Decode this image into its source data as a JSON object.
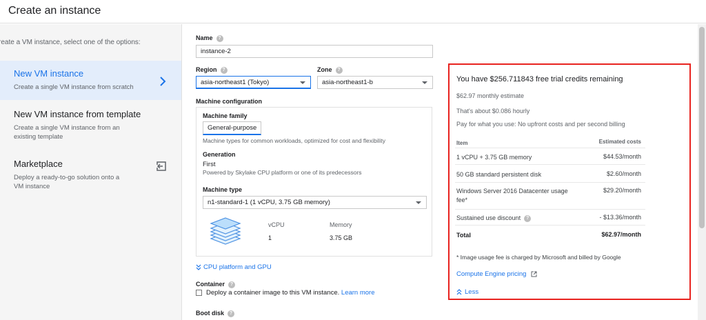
{
  "header": {
    "title": "Create an instance"
  },
  "left": {
    "intro": "reate a VM instance, select one of the options:",
    "options": [
      {
        "title": "New VM instance",
        "desc": "Create a single VM instance from scratch",
        "selected": true,
        "icon": "chevron-right-icon"
      },
      {
        "title": "New VM instance from template",
        "desc": "Create a single VM instance from an existing template",
        "selected": false
      },
      {
        "title": "Marketplace",
        "desc": "Deploy a ready-to-go solution onto a VM instance",
        "selected": false,
        "icon": "exit-to-app-icon"
      }
    ]
  },
  "form": {
    "name_label": "Name",
    "name_value": "instance-2",
    "region_label": "Region",
    "region_value": "asia-northeast1 (Tokyo)",
    "zone_label": "Zone",
    "zone_value": "asia-northeast1-b",
    "machine_config_label": "Machine configuration",
    "machine_family_label": "Machine family",
    "machine_family_value": "General-purpose",
    "machine_family_desc": "Machine types for common workloads, optimized for cost and flexibility",
    "generation_label": "Generation",
    "generation_value": "First",
    "generation_desc": "Powered by Skylake CPU platform or one of its predecessors",
    "machine_type_label": "Machine type",
    "machine_type_value": "n1-standard-1 (1 vCPU, 3.75 GB memory)",
    "vcpu_label": "vCPU",
    "vcpu_value": "1",
    "memory_label": "Memory",
    "memory_value": "3.75 GB",
    "cpu_platform_link": "CPU platform and GPU",
    "container_label": "Container",
    "container_checkbox_text": "Deploy a container image to this VM instance.",
    "learn_more": "Learn more",
    "boot_disk_label": "Boot disk"
  },
  "cost": {
    "headline": "You have $256.711843 free trial credits remaining",
    "monthly_estimate": "$62.97 monthly estimate",
    "hourly": "That's about $0.086 hourly",
    "pay_note": "Pay for what you use: No upfront costs and per second billing",
    "col_item": "Item",
    "col_cost": "Estimated costs",
    "rows": [
      {
        "item": "1 vCPU + 3.75 GB memory",
        "cost": "$44.53/month"
      },
      {
        "item": "50 GB standard persistent disk",
        "cost": "$2.60/month"
      },
      {
        "item": "Windows Server 2016 Datacenter usage fee*",
        "cost": "$29.20/month"
      },
      {
        "item": "Sustained use discount",
        "cost": "- $13.36/month"
      }
    ],
    "total_label": "Total",
    "total_value": "$62.97/month",
    "footnote": "* Image usage fee is charged by Microsoft and billed by Google",
    "pricing_link": "Compute Engine pricing",
    "less_link": "Less"
  },
  "colors": {
    "accent": "#1a73e8",
    "highlight_border": "#e8231f",
    "selected_bg": "#e3edfb"
  }
}
